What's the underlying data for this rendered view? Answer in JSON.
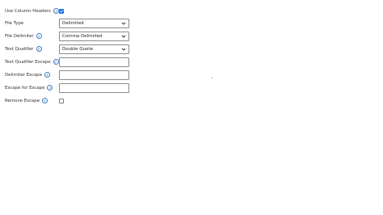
{
  "form": {
    "use_column_headers": {
      "label": "Use Column Headers",
      "checked": true
    },
    "file_type": {
      "label": "File Type",
      "value": "Delimited"
    },
    "file_delimiter": {
      "label": "File Delimiter",
      "value": "Comma Delimited"
    },
    "text_qualifier": {
      "label": "Text Qualifier",
      "value": "Double Quote"
    },
    "text_qualifier_escape": {
      "label": "Text Qualifier Escape",
      "value": ""
    },
    "delimiter_escape": {
      "label": "Delimiter Escape",
      "value": ""
    },
    "escape_for_escape": {
      "label": "Escape for Escape",
      "value": ""
    },
    "remove_escape": {
      "label": "Remove Escape",
      "checked": false
    }
  },
  "icons": {
    "info": "info-icon",
    "dropdown": "chevron-down-icon",
    "check": "checkmark-icon"
  },
  "colors": {
    "accent": "#1a73e8",
    "info": "#3a7bc8",
    "border": "#8a8a8a",
    "text": "#333333"
  }
}
